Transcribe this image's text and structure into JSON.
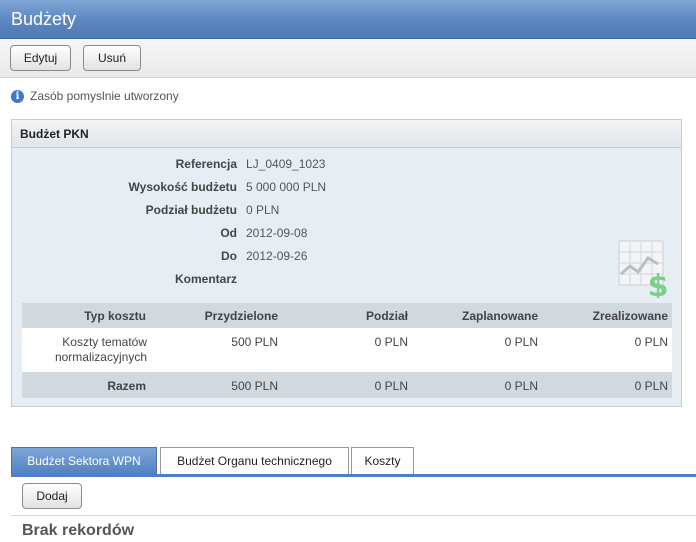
{
  "header": {
    "title": "Budżety"
  },
  "toolbar": {
    "edit_label": "Edytuj",
    "delete_label": "Usuń"
  },
  "message": {
    "text": "Zasób pomyslnie utworzony",
    "icon": "info-icon"
  },
  "panel": {
    "title": "Budżet PKN",
    "fields": [
      {
        "label": "Referencja",
        "value": "LJ_0409_1023"
      },
      {
        "label": "Wysokość budżetu",
        "value": "5 000 000 PLN"
      },
      {
        "label": "Podział budżetu",
        "value": "0 PLN"
      },
      {
        "label": "Od",
        "value": "2012-09-08"
      },
      {
        "label": "Do",
        "value": "2012-09-26"
      },
      {
        "label": "Komentarz",
        "value": ""
      }
    ],
    "table": {
      "headers": [
        "Typ kosztu",
        "Przydzielone",
        "Podział",
        "Zaplanowane",
        "Zrealizowane"
      ],
      "rows": [
        {
          "type_line1": "Koszty tematów",
          "type_line2": "normalizacyjnych",
          "allocated": "500 PLN",
          "split": "0 PLN",
          "planned": "0 PLN",
          "realized": "0 PLN"
        }
      ],
      "total": {
        "label": "Razem",
        "allocated": "500 PLN",
        "split": "0 PLN",
        "planned": "0 PLN",
        "realized": "0 PLN"
      }
    }
  },
  "tabs": [
    {
      "label": "Budżet Sektora WPN",
      "active": true
    },
    {
      "label": "Budżet Organu technicznego",
      "active": false
    },
    {
      "label": "Koszty",
      "active": false
    }
  ],
  "subtoolbar": {
    "add_label": "Dodaj"
  },
  "empty_text": "Brak rekordów",
  "colors": {
    "header": "#5c86c0",
    "accent": "#4f7fc0",
    "panel_bg": "#e7eef3"
  }
}
